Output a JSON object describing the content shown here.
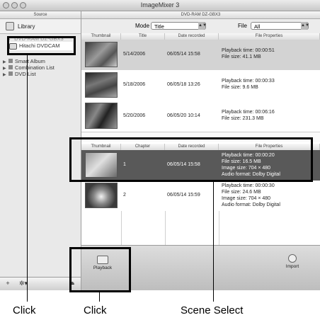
{
  "window": {
    "title": "ImageMixer 3"
  },
  "sidebar": {
    "header": "Source",
    "library": "Library",
    "items": [
      {
        "label": "DVD-RAM DZ-GBX3",
        "expanded": false
      },
      {
        "label": "Hitachi DVDCAM",
        "selected": true
      },
      {
        "label": "Smart Album"
      },
      {
        "label": "Combination List"
      },
      {
        "label": "DVD List"
      }
    ]
  },
  "main": {
    "disc_label": "DVD-RAM DZ-GBX3",
    "mode_label": "Mode",
    "mode_value": "Title",
    "file_label": "File",
    "file_value": "All"
  },
  "title_table": {
    "columns": [
      "Thumbnail",
      "Title",
      "Date recorded",
      "File Properties"
    ],
    "rows": [
      {
        "title": "5/14/2006",
        "date": "06/05/14 15:58",
        "props": [
          "Playback time: 00:00:51",
          "File size: 41.1 MB"
        ]
      },
      {
        "title": "5/18/2006",
        "date": "06/05/18 13:26",
        "props": [
          "Playback time: 00:00:33",
          "File size: 9.6 MB"
        ]
      },
      {
        "title": "5/20/2006",
        "date": "06/05/20 10:14",
        "props": [
          "Playback time: 00:06:16",
          "File size: 231.3 MB"
        ]
      }
    ]
  },
  "scene_table": {
    "columns": [
      "Thumbnail",
      "Chapter",
      "Date recorded",
      "File Properties"
    ],
    "rows": [
      {
        "chapter": "1",
        "date": "06/05/14 15:58",
        "props": [
          "Playback time: 00:00:20",
          "File size: 16.5 MB",
          "Image size: 704 × 480",
          "Audio format: Dolby Digital"
        ],
        "selected": true
      },
      {
        "chapter": "2",
        "date": "06/05/14 15:59",
        "props": [
          "Playback time: 00:00:30",
          "File size: 24.6 MB",
          "Image size: 704 × 480",
          "Audio format: Dolby Digital"
        ]
      }
    ]
  },
  "bottom": {
    "playback_label": "Playback",
    "import_label": "Import"
  },
  "captions": {
    "click_left": "Click",
    "click_middle": "Click",
    "scene_select": "Scene Select"
  }
}
